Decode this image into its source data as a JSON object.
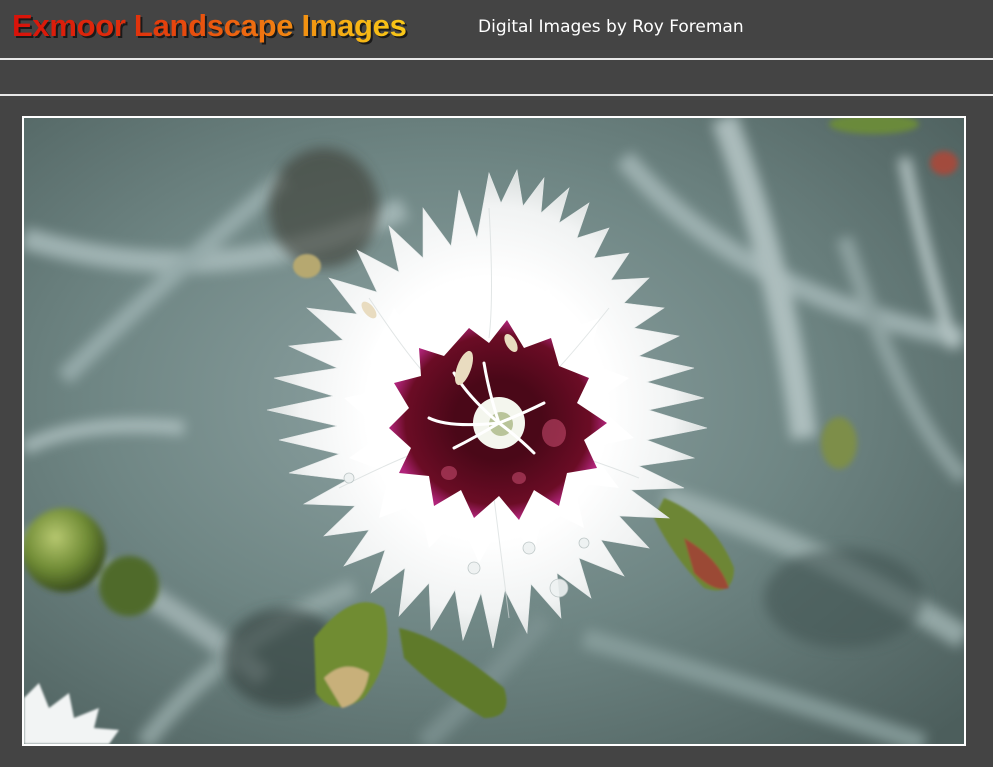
{
  "header": {
    "site_title": "Exmoor Landscape Images",
    "subtitle": "Digital Images by Roy Foreman"
  },
  "photo": {
    "subject": "flower-photo"
  },
  "colors": {
    "background": "#444444",
    "title_gradient_start": "#d8120a",
    "title_gradient_end": "#f8c818",
    "rule": "#e8e8e8"
  }
}
